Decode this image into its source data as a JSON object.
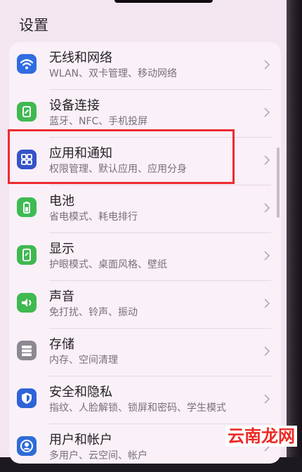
{
  "header": {
    "title": "设置"
  },
  "items": [
    {
      "title": "无线和网络",
      "subtitle": "WLAN、双卡管理、移动网络",
      "icon": "wifi-icon",
      "color": "#2f6de1"
    },
    {
      "title": "设备连接",
      "subtitle": "蓝牙、NFC、手机投屏",
      "icon": "device-connect-icon",
      "color": "#3fb950"
    },
    {
      "title": "应用和通知",
      "subtitle": "权限管理、默认应用、应用分身",
      "icon": "apps-grid-icon",
      "color": "#3553c9"
    },
    {
      "title": "电池",
      "subtitle": "省电模式、耗电排行",
      "icon": "battery-icon",
      "color": "#3dbb52"
    },
    {
      "title": "显示",
      "subtitle": "护眼模式、桌面风格、壁纸",
      "icon": "display-icon",
      "color": "#3fb950"
    },
    {
      "title": "声音",
      "subtitle": "免打扰、铃声、振动",
      "icon": "speaker-icon",
      "color": "#3fb950"
    },
    {
      "title": "存储",
      "subtitle": "内存、空间清理",
      "icon": "storage-icon",
      "color": "#8d8891"
    },
    {
      "title": "安全和隐私",
      "subtitle": "指纹、人脸解锁、锁屏和密码、学生模式",
      "icon": "shield-icon",
      "color": "#2e63d8"
    },
    {
      "title": "用户和帐户",
      "subtitle": "多用户、云空间、帐户",
      "icon": "user-icon",
      "color": "#2e6bd6"
    }
  ],
  "watermark": {
    "text": "云南龙网"
  },
  "colors": {
    "highlight": "#f02a31",
    "chevron": "#b8adb7"
  }
}
